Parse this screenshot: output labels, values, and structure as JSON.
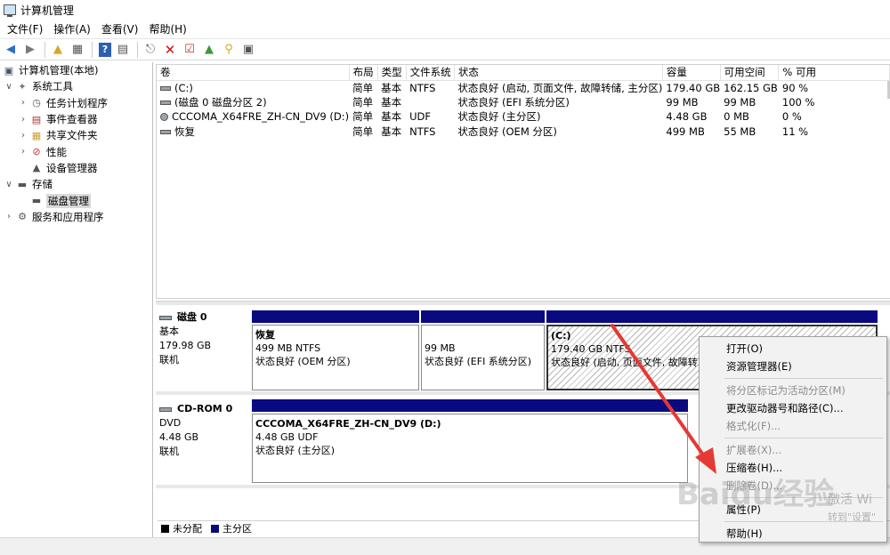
{
  "window": {
    "title": "计算机管理"
  },
  "menu": [
    "文件(F)",
    "操作(A)",
    "查看(V)",
    "帮助(H)"
  ],
  "toolbar": {
    "icons": [
      "back-icon",
      "forward-icon",
      "up-folder-icon",
      "show-hide-tree-icon",
      "help-icon",
      "properties-icon",
      "connect-icon",
      "delete-icon",
      "check-icon",
      "import-icon",
      "search-icon",
      "console-icon"
    ]
  },
  "tree": {
    "root": "计算机管理(本地)",
    "system_tools": "系统工具",
    "task_scheduler": "任务计划程序",
    "event_viewer": "事件查看器",
    "shared_folders": "共享文件夹",
    "performance": "性能",
    "device_manager": "设备管理器",
    "storage": "存储",
    "disk_management": "磁盘管理",
    "services_apps": "服务和应用程序"
  },
  "volumes": {
    "headers": [
      "卷",
      "布局",
      "类型",
      "文件系统",
      "状态",
      "容量",
      "可用空间",
      "% 可用"
    ],
    "rows": [
      [
        "(C:)",
        "简单",
        "基本",
        "NTFS",
        "状态良好 (启动, 页面文件, 故障转储, 主分区)",
        "179.40 GB",
        "162.15 GB",
        "90 %"
      ],
      [
        "(磁盘 0 磁盘分区 2)",
        "简单",
        "基本",
        "",
        "状态良好 (EFI 系统分区)",
        "99 MB",
        "99 MB",
        "100 %"
      ],
      [
        "CCCOMA_X64FRE_ZH-CN_DV9 (D:)",
        "简单",
        "基本",
        "UDF",
        "状态良好 (主分区)",
        "4.48 GB",
        "0 MB",
        "0 %"
      ],
      [
        "恢复",
        "简单",
        "基本",
        "NTFS",
        "状态良好 (OEM 分区)",
        "499 MB",
        "55 MB",
        "11 %"
      ]
    ]
  },
  "disk0": {
    "name": "磁盘 0",
    "type": "基本",
    "size": "179.98 GB",
    "status": "联机",
    "partitions": [
      {
        "name": "恢复",
        "line1": "499 MB NTFS",
        "line2": "状态良好 (OEM 分区)"
      },
      {
        "name": "",
        "line1": "99 MB",
        "line2": "状态良好 (EFI 系统分区)"
      },
      {
        "name": "(C:)",
        "line1": "179.40 GB NTFS",
        "line2": "状态良好 (启动, 页面文件, 故障转"
      }
    ]
  },
  "cdrom0": {
    "name": "CD-ROM 0",
    "type": "DVD",
    "size": "4.48 GB",
    "status": "联机",
    "partition": {
      "name": "CCCOMA_X64FRE_ZH-CN_DV9  (D:)",
      "line1": "4.48 GB UDF",
      "line2": "状态良好 (主分区)"
    }
  },
  "legend": {
    "unallocated": "未分配",
    "primary": "主分区",
    "unallocated_color": "#000000",
    "primary_color": "#0a0a80"
  },
  "context_menu": {
    "open": "打开(O)",
    "explorer": "资源管理器(E)",
    "mark_active": "将分区标记为活动分区(M)",
    "change_letter": "更改驱动器号和路径(C)...",
    "format": "格式化(F)...",
    "extend": "扩展卷(X)...",
    "shrink": "压缩卷(H)...",
    "delete": "删除卷(D)...",
    "properties": "属性(P)",
    "help": "帮助(H)"
  },
  "overlay": {
    "watermark": "Baidu经验",
    "activation_line1": "激活 Wi",
    "activation_line2": "转到\"设置\"",
    "arrow_color": "#e53935"
  }
}
